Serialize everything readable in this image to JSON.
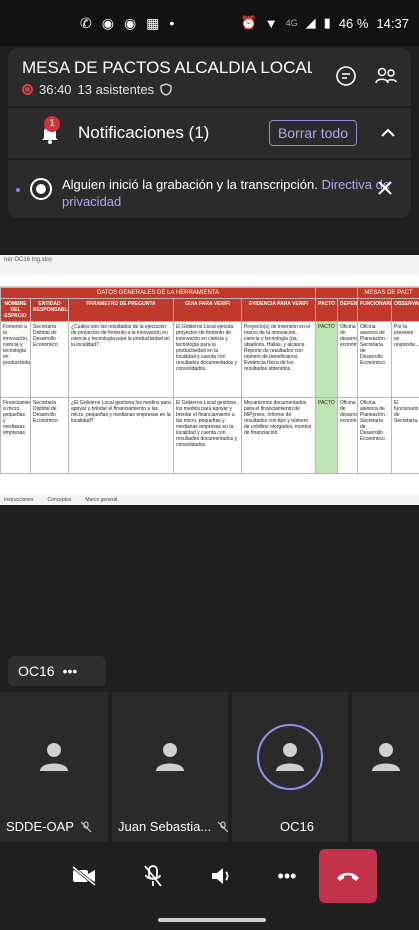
{
  "status_bar": {
    "battery": "46 %",
    "time": "14:37",
    "network": "4G"
  },
  "meeting": {
    "title": "MESA DE PACTOS ALCALDIA LOCAL DE ...",
    "duration": "36:40",
    "attendees": "13 asistentes"
  },
  "notifications": {
    "title": "Notificaciones (1)",
    "badge": "1",
    "clear_all": "Borrar todo",
    "item_text": "Alguien inició la grabación y la transcripción.",
    "item_link": "Directiva de privacidad"
  },
  "shared_sheet": {
    "filename": "ner OC16 Ing.xlsx",
    "group_general": "DATOS GENERALES DE LA HERRAMIENTA",
    "group_mesa": "MESAS DE PACT",
    "headers": [
      "NOMBRE DEL ESPACIO",
      "ENTIDAD RESPONSABLE",
      "PARAMETRO DE PREGUNTA",
      "GUIA PARA VERIFI",
      "EVIDENCIA PARA VERIFI",
      "PACTO",
      "DEPENDENCIA",
      "FUNCIONARIO",
      "OBSERVAPACTOS"
    ],
    "rows": [
      {
        "c0": "Fomento a la innovación, ciencia y tecnología en productividad",
        "c1": "Secretaría Distrital de Desarrollo Económico",
        "c2": "¿Cuáles son los resultados de la ejecución de proyectos de fomento a la innovación en ciencia y tecnología para la productividad en la localidad?",
        "c3": "El Gobierno Local ejecuta proyectos de fomento de innovación en ciencia y tecnología para la productividad en la localidad y cuenta con resultados documentados y consolidados.",
        "c4": "Proyecto(s) de inversión en el marco de la innovación, ciencia y tecnología (pa, ubiations, Hallas, y alcance. Reporte de resultados con número de beneficiarios. Evidencia física de los resultados obtenidos.",
        "c5": "PACTO",
        "c6": "Oficina de desarrollo económico",
        "c7": "Oficina asesora de Planeación - Secretaria de Desarrollo Económico",
        "c8": "Por la presente se responde..."
      },
      {
        "c0": "Financiamiento a micro, pequeñas y medianas empresas",
        "c1": "Secretaría Distrital de Desarrollo Económico",
        "c2": "¿El Gobierno Local gestiona los medios para apoyar y brindar el financiamiento a las micro, pequeñas y medianas empresas en la localidad?",
        "c3": "El Gobierno Local gestiona los medios para apoyar y brindar el financiamiento a las micro, pequeñas y medianas empresas en la localidad y cuenta con resultados documentados y consolidados.",
        "c4": "Mecanismos documentados para el financiamiento de MiPymes. Informe de resultados con tipo y número de créditos otorgados, montos de financiación.",
        "c5": "PACTO",
        "c6": "Oficina de desarrollo económico",
        "c7": "Oficina asesora de Planeación - Secretaria de Desarrollo Económico",
        "c8": "El funcionario de Secretaría..."
      }
    ],
    "tabs": [
      "Instrucciones",
      "Conceptos",
      "Marco general"
    ]
  },
  "participant_pill": {
    "label": "OC16",
    "more": "•••"
  },
  "gallery": [
    {
      "name": "SDDE-OAP",
      "muted": true
    },
    {
      "name": "Juan Sebastia...",
      "muted": true
    },
    {
      "name": "OC16",
      "muted": false,
      "speaking": true
    },
    {
      "name": "",
      "muted": false
    }
  ],
  "controls": {
    "more": "•••"
  },
  "colors": {
    "accent": "#7f85f5",
    "hangup": "#c4314b",
    "record": "#e0413b"
  }
}
